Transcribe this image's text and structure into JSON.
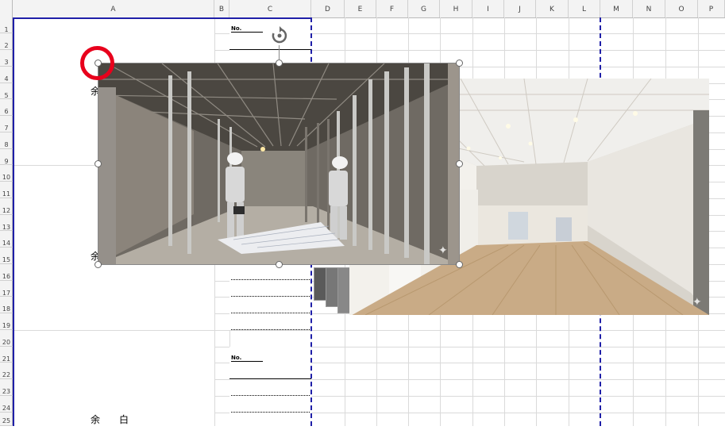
{
  "columns": [
    "A",
    "B",
    "C",
    "D",
    "E",
    "F",
    "G",
    "H",
    "I",
    "J",
    "K",
    "L",
    "M",
    "N",
    "O",
    "P"
  ],
  "rows": [
    "1",
    "2",
    "3",
    "4",
    "5",
    "6",
    "7",
    "8",
    "9",
    "10",
    "11",
    "12",
    "13",
    "14",
    "15",
    "16",
    "17",
    "18",
    "19",
    "20",
    "21",
    "22",
    "23",
    "24",
    "25"
  ],
  "cells": {
    "a4_char": "余",
    "a15_char": "余",
    "a25_text": "余　　白",
    "b1_label": "No.",
    "b21_label": "No."
  },
  "colors": {
    "page_break": "#1f1fa8",
    "highlight_circle": "#e8001c",
    "gridline": "#dadada",
    "header_bg": "#f3f3f3"
  },
  "images": {
    "front": "construction-site-photo",
    "back": "finished-office-photo"
  }
}
